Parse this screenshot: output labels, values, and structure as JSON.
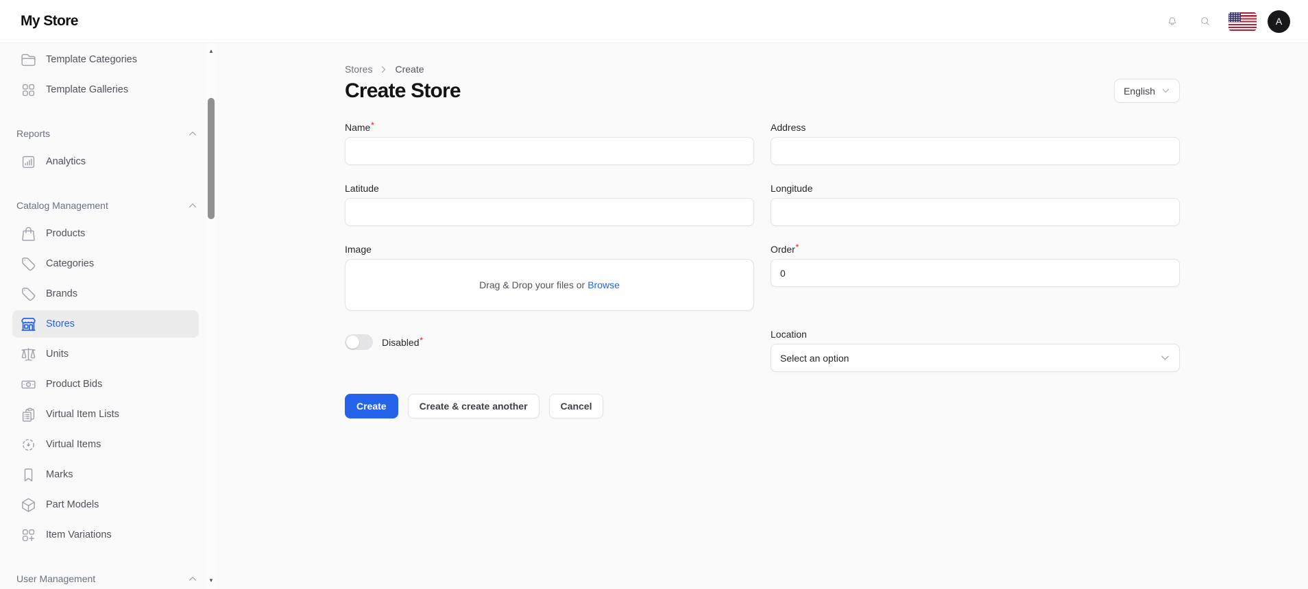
{
  "topbar": {
    "brand": "My Store",
    "avatar_initial": "A",
    "icons": {
      "notifications": "bell-icon",
      "search": "magnifier-icon",
      "language_flag": "us-flag-icon",
      "avatar": "user-avatar"
    }
  },
  "sidebar": {
    "top_items": [
      {
        "label": "Template Categories",
        "icon": "folder-icon"
      },
      {
        "label": "Template Galleries",
        "icon": "grid-squares-icon"
      }
    ],
    "sections": [
      {
        "label": "Reports",
        "items": [
          {
            "label": "Analytics",
            "icon": "chart-bar-icon"
          }
        ]
      },
      {
        "label": "Catalog Management",
        "items": [
          {
            "label": "Products",
            "icon": "shopping-bag-icon"
          },
          {
            "label": "Categories",
            "icon": "tag-icon"
          },
          {
            "label": "Brands",
            "icon": "tag-icon"
          },
          {
            "label": "Stores",
            "icon": "storefront-icon",
            "active": true
          },
          {
            "label": "Units",
            "icon": "scale-icon"
          },
          {
            "label": "Product Bids",
            "icon": "banknote-icon"
          },
          {
            "label": "Virtual Item Lists",
            "icon": "clipboard-list-icon"
          },
          {
            "label": "Virtual Items",
            "icon": "dashed-circle-icon"
          },
          {
            "label": "Marks",
            "icon": "bookmark-icon"
          },
          {
            "label": "Part Models",
            "icon": "cube-icon"
          },
          {
            "label": "Item Variations",
            "icon": "squares-plus-icon"
          }
        ]
      },
      {
        "label": "User Management",
        "items": []
      }
    ]
  },
  "breadcrumb": {
    "items": [
      {
        "label": "Stores"
      },
      {
        "label": "Create"
      }
    ]
  },
  "page": {
    "title": "Create Store",
    "language_selector": "English"
  },
  "form": {
    "name": {
      "label": "Name",
      "required": true,
      "value": "",
      "placeholder": ""
    },
    "address": {
      "label": "Address",
      "required": false,
      "value": "",
      "placeholder": ""
    },
    "latitude": {
      "label": "Latitude",
      "required": false,
      "value": "",
      "placeholder": ""
    },
    "longitude": {
      "label": "Longitude",
      "required": false,
      "value": "",
      "placeholder": ""
    },
    "image": {
      "label": "Image",
      "dropzone_text": "Drag & Drop your files or",
      "browse_label": "Browse"
    },
    "order": {
      "label": "Order",
      "required": true,
      "value": "0"
    },
    "disabled": {
      "label": "Disabled",
      "required": true,
      "state": "off"
    },
    "location": {
      "label": "Location",
      "selected": "Select an option"
    },
    "actions": {
      "create": "Create",
      "create_another": "Create & create another",
      "cancel": "Cancel"
    }
  },
  "colors": {
    "accent": "#2563eb",
    "required_marker": "#ef4444",
    "link": "#2563eb",
    "page_background": "#fafafa",
    "active_item_background": "#ececec"
  }
}
